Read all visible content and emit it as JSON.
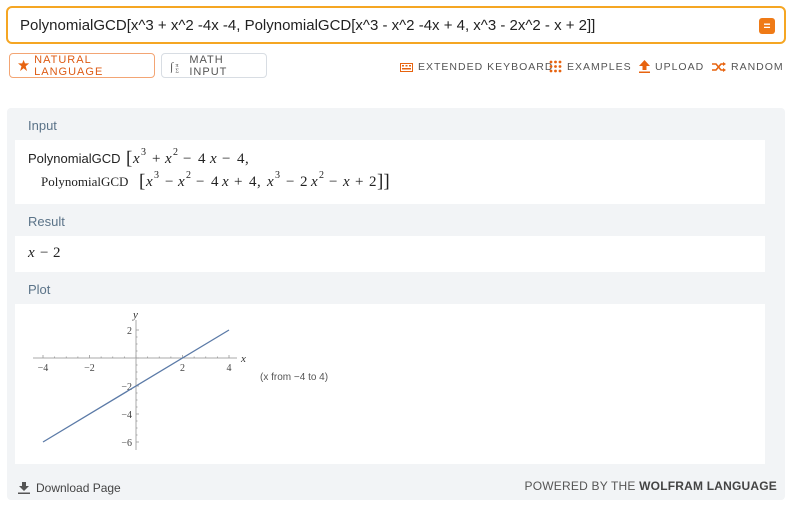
{
  "search": {
    "query": "PolynomialGCD[x^3 + x^2 -4x -4, PolynomialGCD[x^3 - x^2 -4x + 4, x^3 - 2x^2 - x + 2]]",
    "equals_icon": "equals-icon"
  },
  "modes": {
    "natural_language": "NATURAL LANGUAGE",
    "math_input": "MATH INPUT"
  },
  "tools": {
    "extended_keyboard": "EXTENDED KEYBOARD",
    "examples": "EXAMPLES",
    "upload": "UPLOAD",
    "random": "RANDOM"
  },
  "pods": {
    "input": {
      "title": "Input",
      "fn": "PolynomialGCD",
      "x": "x",
      "minus": "−",
      "plus": "+",
      "four": "4",
      "two": "2",
      "three": "3",
      "comma": ","
    },
    "result": {
      "title": "Result",
      "x": "x",
      "minus": "−",
      "two": "2"
    },
    "plot": {
      "title": "Plot",
      "range_note": "(x from −4 to 4)"
    }
  },
  "chart_data": {
    "type": "line",
    "xlabel": "x",
    "ylabel": "y",
    "xlim": [
      -4,
      4
    ],
    "ylim": [
      -6,
      2
    ],
    "xticks": [
      -4,
      -2,
      2,
      4
    ],
    "xtick_labels": [
      "−4",
      "−2",
      "2",
      "4"
    ],
    "yticks": [
      2,
      -2,
      -4,
      -6
    ],
    "ytick_labels": [
      "2",
      "−2",
      "−4",
      "−6"
    ],
    "series": [
      {
        "x": [
          -4,
          4
        ],
        "y": [
          -6,
          2
        ],
        "color": "#5b7aa7"
      }
    ]
  },
  "footer": {
    "download": "Download Page",
    "powered_prefix": "POWERED BY THE",
    "powered_brand": "WOLFRAM LANGUAGE"
  },
  "colors": {
    "accent": "#ef7a16",
    "search_border": "#f5a623",
    "pod_title": "#5b7388",
    "plot_line": "#5b7aa7"
  }
}
